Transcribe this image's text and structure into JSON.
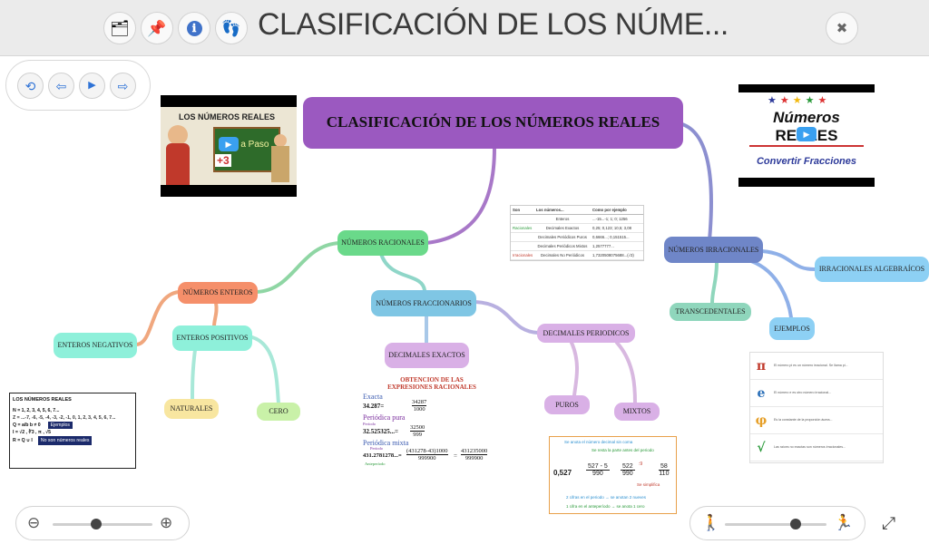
{
  "window": {
    "title": "CLASIFICACIÓN DE LOS NÚME...",
    "close_symbol": "✖"
  },
  "toolbar": {
    "folder_symbol": "🗂",
    "pin_symbol": "📌",
    "info_symbol": "ℹ",
    "footprint_symbol": "👣"
  },
  "nav": {
    "refresh_symbol": "⟲",
    "back_symbol": "⇦",
    "play_symbol": "▶",
    "forward_symbol": "⇨"
  },
  "map": {
    "central": "CLASIFICACIÓN DE LOS NÚMEROS REALES",
    "racionales": "NÚMEROS RACIONALES",
    "enteros": "NÚMEROS ENTEROS",
    "fraccionarios": "NÚMEROS FRACCIONARIOS",
    "irracionales": "NÚMEROS IRRACIONALES",
    "negativos": "ENTEROS NEGATIVOS",
    "positivos": "ENTEROS POSITIVOS",
    "naturales": "NATURALES",
    "cero": "CERO",
    "exactos": "DECIMALES EXACTOS",
    "periodicos": "DECIMALES PERIODICOS",
    "puros": "PUROS",
    "mixtos": "MIXTOS",
    "transcendentales": "TRANSCEDENTALES",
    "algebraicos": "IRRACIONALES ALGEBRAÍCOS",
    "ejemplos": "EJEMPLOS"
  },
  "videos": {
    "left_title": "LOS NÚMEROS REALES",
    "left_board": "o a Paso",
    "left_math": "+3",
    "right_line1": "Números",
    "right_line2": "REALES",
    "right_line3": "Convertir Fracciones",
    "play_symbol": "▶"
  },
  "table": {
    "headers": [
      "Son",
      "Los números...",
      "Como por ejemplo"
    ],
    "rows": [
      {
        "group": "",
        "name": "Enteros",
        "example": "...-15...-1; 1; 0; 1256"
      },
      {
        "group": "Racionales",
        "name": "Decimales Exactos",
        "example": "0,25; 0,123; 10,5; 3,08"
      },
      {
        "group": "",
        "name": "Decimales Periódicos Puros",
        "example": "0,6666...; 0,151515..."
      },
      {
        "group": "",
        "name": "Decimales Periódicos Mixtos",
        "example": "1,2577777..."
      },
      {
        "group": "Irracionales",
        "name": "Decimales No Periódicos",
        "example": "1,7320508075688...(√3)"
      }
    ]
  },
  "sets": {
    "title": "LOS NÚMEROS REALES",
    "n": "N =  1, 2, 3, 4, 5, 6, 7...",
    "z": "Z = ...-7, -6, -5, -4, -3, -2, -1, 0, 1, 2, 3, 4, 5, 6, 7...",
    "q": "Q = a/b   b ≠ 0",
    "ejemplos": "Ejemplos",
    "i": "I =  √2 , ∛3 , π , √5",
    "no_reales": "No son números reales",
    "r": "R = Q ∪ I"
  },
  "obtencion": {
    "title": "OBTENCIÓN DE LAS EXPRESIONES RACIONALES",
    "exacta": "Exacta",
    "exacta_eq": "34.287=",
    "exacta_num": "34287",
    "exacta_den": "1000",
    "pura": "Periódica pura",
    "periodo": "Período",
    "pura_eq": "32.525325...=",
    "pura_num": "32500",
    "pura_den": "999",
    "mixta": "Periódica mixta",
    "periodo2": "Período",
    "mixta_eq": "431.278127​8...=",
    "mixta_num": "(431278-43)1000",
    "mixta_den": "999900",
    "mixta_eq2": "=",
    "mixta_num2": "431235000",
    "mixta_den2": "999900",
    "anteperiodo": "Anteperíodo"
  },
  "decimal_card": {
    "line1": "Se anota el número decimal sin coma",
    "line2": "Se resta la parte antes del periodo",
    "lhs": "0,527",
    "f1_num": "527 - 5",
    "f1_den": "990",
    "f2_num": "522",
    "f2_den": "990",
    "f3_num": "58",
    "f3_den": "110",
    "div": ":9",
    "simplifica": "Se simplifica",
    "note1": "2 cifras en el periodo → se anotan 2 nueves",
    "note2": "1 cifra en el anteperíodo → se anota 1 cero"
  },
  "irr_card": {
    "symbols": [
      "π",
      "e",
      "φ",
      "√"
    ],
    "texts": [
      "El número pi es un número irracional. Se llama pi...",
      "El número e es otro número irracional...",
      "Es la constante de la proporción áurea...",
      "Las raíces no exactas son números irracionales..."
    ]
  },
  "zoom": {
    "out_symbol": "⊖",
    "in_symbol": "⊕",
    "level": 0.44,
    "speed_level": 0.7,
    "slow_symbol": "🚶",
    "fast_symbol": "🏃",
    "fullscreen_symbol": "⤢"
  },
  "colors": {
    "central": "#9b59c0",
    "racionales": "#6ad98a",
    "enteros": "#f58f6a",
    "fraccionarios": "#7fc6e4",
    "irracionales": "#6f86c8",
    "teal": "#8ef0da",
    "naturales": "#f8e6a0",
    "cero": "#c9f1a8",
    "lilac": "#d9b0e6",
    "transcend": "#8fd6bc",
    "algebraic": "#8dd0f4"
  }
}
